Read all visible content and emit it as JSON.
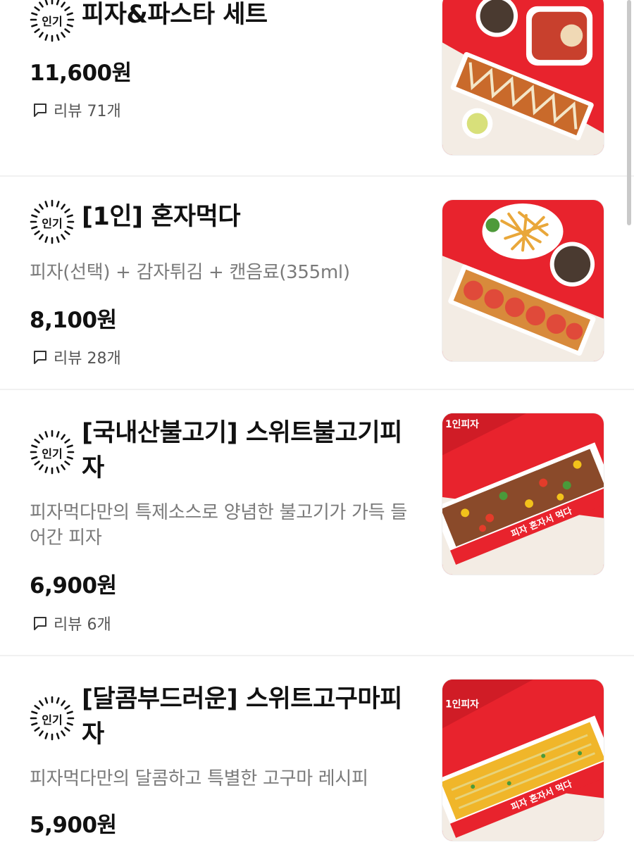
{
  "menu": {
    "items": [
      {
        "badge": "인기",
        "title_lines": [
          "피자&파스타 세트"
        ],
        "description_lines": [],
        "price": "11,600원",
        "review_label": "리뷰 71개"
      },
      {
        "badge": "인기",
        "title_lines": [
          "[1인] 혼자먹다"
        ],
        "description_lines": [
          "피자(선택) + 감자튀김 + 캔음료(355ml)"
        ],
        "price": "8,100원",
        "review_label": "리뷰 28개"
      },
      {
        "badge": "인기",
        "title_lines": [
          "[국내산불고기] 스위트불고기피",
          "자"
        ],
        "description_lines": [
          "피자먹다만의 특제소스로 양념한 불고기가 가득 들",
          "어간 피자"
        ],
        "price": "6,900원",
        "review_label": "리뷰 6개"
      },
      {
        "badge": "인기",
        "title_lines": [
          "[달콤부드러운] 스위트고구마피",
          "자"
        ],
        "description_lines": [
          "피자먹다만의 달콤하고 특별한 고구마 레시피"
        ],
        "price": "5,900원",
        "review_label": ""
      }
    ]
  },
  "package_text": {
    "brand_line": "피자 혼자서 먹다",
    "side_line": "1인피자"
  },
  "colors": {
    "accent_red": "#e8232d",
    "price_text": "#111111",
    "description_text": "#7a7a7a"
  },
  "icons": {
    "badge": "popular-badge-icon",
    "review": "speech-bubble-icon"
  }
}
